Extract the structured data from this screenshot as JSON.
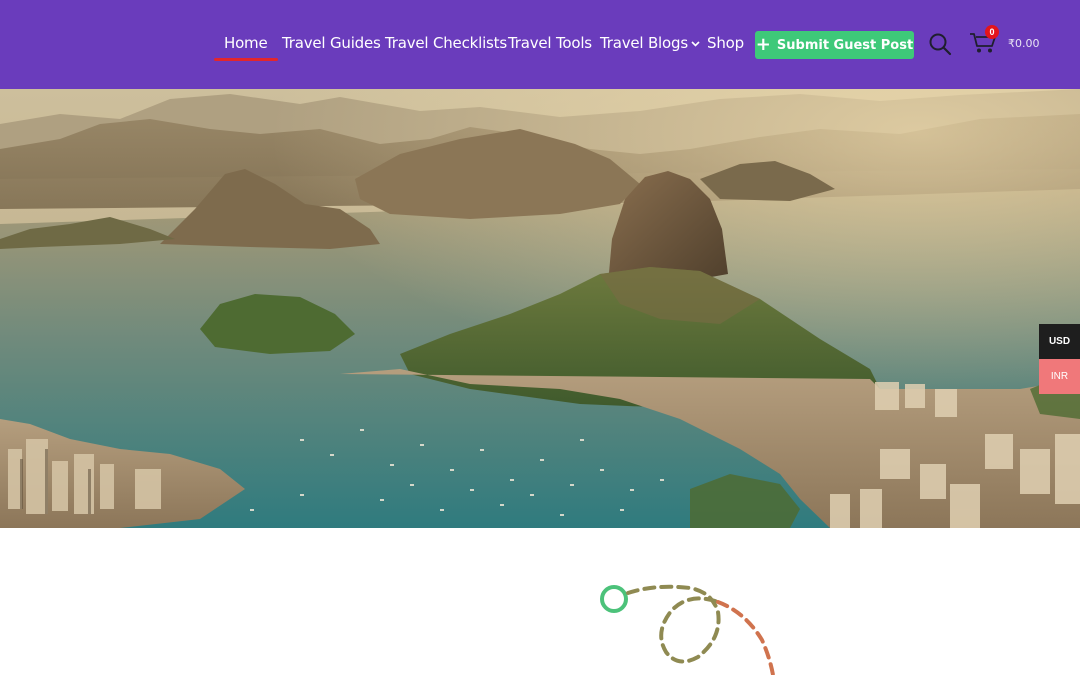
{
  "nav": {
    "items": [
      {
        "label": "Home",
        "active": true
      },
      {
        "label": "Travel Guides"
      },
      {
        "label": "Travel Checklists"
      },
      {
        "label": "Travel Tools"
      },
      {
        "label": "Travel Blogs",
        "has_dropdown": true
      },
      {
        "label": "Shop"
      }
    ]
  },
  "header": {
    "submit_button": "Submit Guest Post",
    "search_icon": "search-icon",
    "cart_icon": "cart-icon",
    "cart_count": "0",
    "cart_total": "₹0.00"
  },
  "currency": {
    "options": [
      "USD",
      "INR"
    ],
    "selected": "USD"
  },
  "colors": {
    "header_bg": "#6a3cbc",
    "active_underline": "#e3262c",
    "submit_button": "#3ec979",
    "cart_badge": "#e3141c",
    "currency_usd_bg": "#1e1e1e",
    "currency_inr_bg": "#f0787a"
  }
}
